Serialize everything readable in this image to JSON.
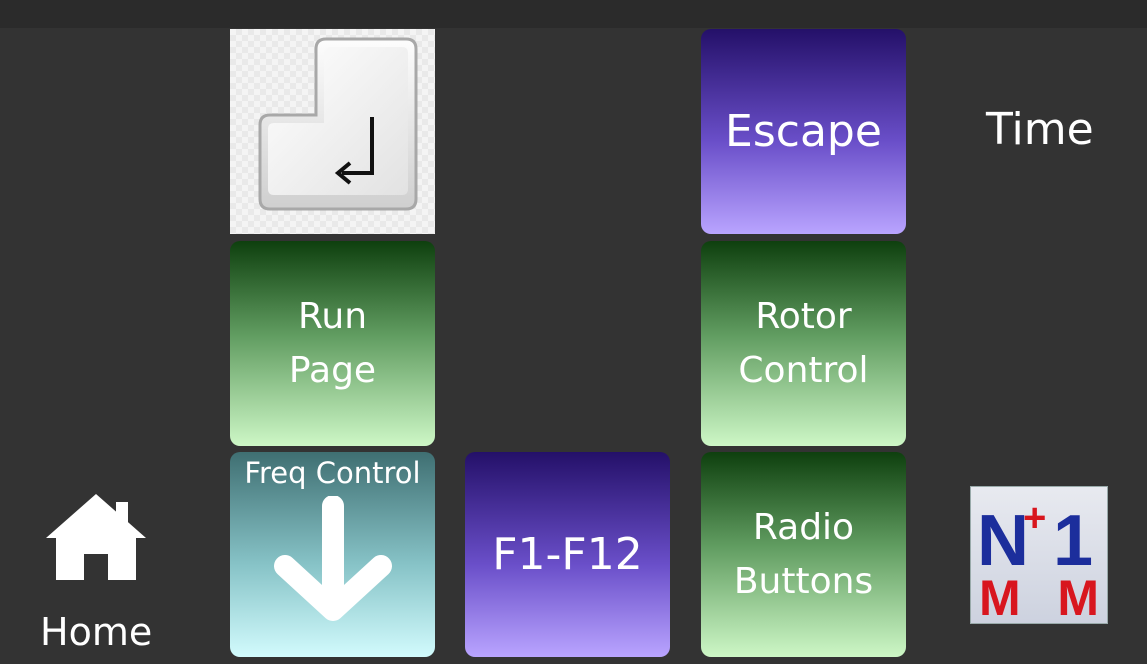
{
  "tiles": {
    "escape": "Escape",
    "run_page": [
      "Run",
      "Page"
    ],
    "rotor_control": [
      "Rotor",
      "Control"
    ],
    "freq_control": "Freq Control",
    "f1_f12": "F1-F12",
    "radio_buttons": [
      "Radio",
      "Buttons"
    ]
  },
  "labels": {
    "time": "Time",
    "home": "Home"
  },
  "icons": {
    "enter": "enter-key-icon",
    "home": "home-icon",
    "freq_arrow": "arrow-down-icon",
    "logo": "n1mm-logo"
  },
  "logo_text": "N+1 MM",
  "colors": {
    "background": "#333333",
    "green_top": "#0e3f0e",
    "green_bottom": "#cdf7c6",
    "purple_top": "#241069",
    "purple_bottom": "#b9a4ff",
    "teal_top": "#3f6f72",
    "teal_bottom": "#d2fbfd"
  }
}
